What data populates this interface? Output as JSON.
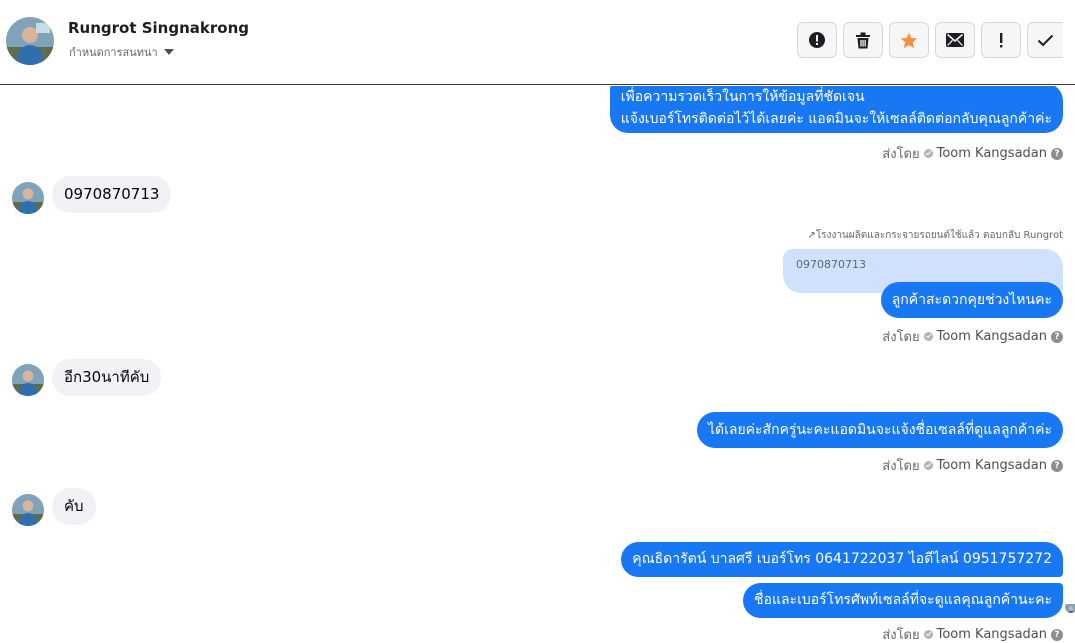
{
  "header": {
    "name": "Rungrot Singnakrong",
    "subtitle": "กำหนดการสนทนา",
    "actions": [
      {
        "icon": "alert-circle-icon"
      },
      {
        "icon": "trash-icon"
      },
      {
        "icon": "star-icon",
        "color": "#f7923a"
      },
      {
        "icon": "envelope-icon"
      },
      {
        "icon": "exclamation-icon"
      },
      {
        "icon": "checkmark-icon"
      }
    ]
  },
  "colors": {
    "outgoing_bubble": "#1877f2",
    "incoming_bubble": "#f0f2f5"
  },
  "messages": {
    "m1_line1": "เพื่อความรวดเร็วในการให้ข้อมูลที่ชัดเจน",
    "m1_line2": "แจ้งเบอร์โทรติดต่อไว้ได้เลยค่ะ แอดมินจะให้เซลล์ติดต่อกลับคุณลูกค้าค่ะ",
    "in1": "0970870713",
    "reply_note": "โรงงานผลิตและกระจายรถยนต์ใช้แล้ว ตอบกลับ Rungrot",
    "quoted": "0970870713",
    "m2": "ลูกค้าสะดวกคุยช่วงไหนคะ",
    "in2": "อีก30นาทีคับ",
    "m3": "ได้เลยค่ะสักครู่นะคะแอดมินจะแจ้งชื่อเซลล์ที่ดูแลลูกค้าค่ะ",
    "in3": "คับ",
    "m4": "คุณธิดารัตน์ บาลศรี เบอร์โทร 0641722037  ไอดีไลน์ 0951757272",
    "m5": "ชื่อและเบอร์โทรศัพท์เซลล์ที่จะดูแลคุณลูกค้านะคะ"
  },
  "sent_by": {
    "prefix": "ส่งโดย",
    "agent": "Toom Kangsadan",
    "help": "?"
  }
}
